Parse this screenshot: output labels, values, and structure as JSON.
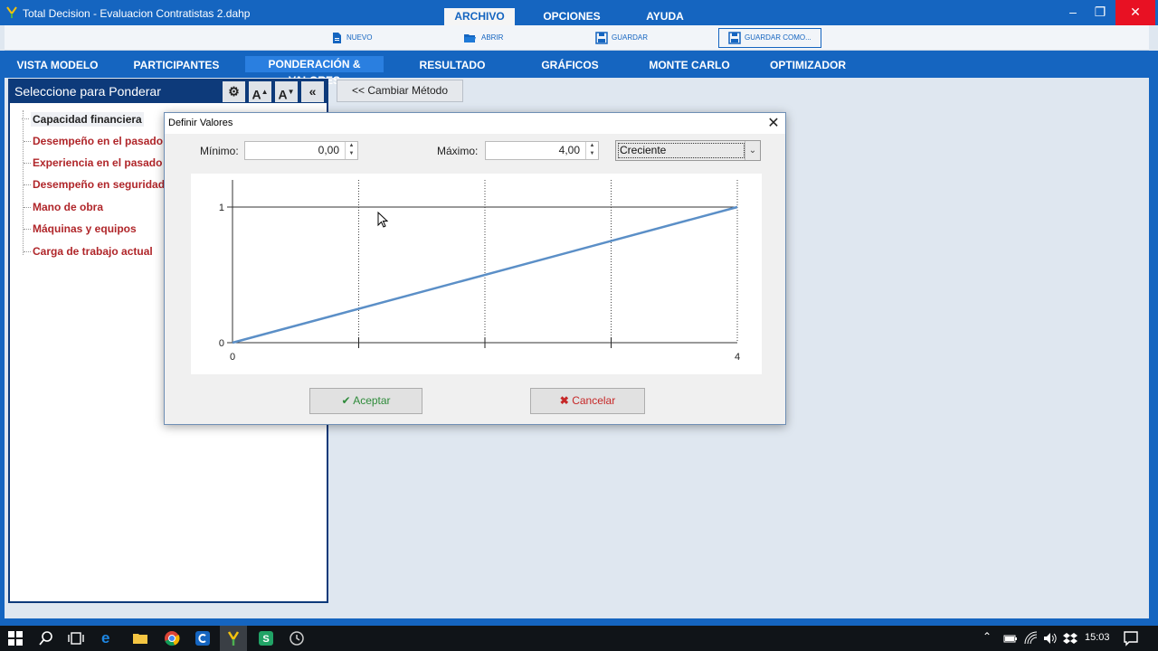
{
  "app": {
    "title": "Total Decision - Evaluacion Contratistas 2.dahp",
    "menu": [
      "ARCHIVO",
      "OPCIONES",
      "AYUDA"
    ],
    "window_controls": {
      "minimize": "–",
      "restore": "❐",
      "close": "✕"
    }
  },
  "toolbar": {
    "nuevo": "NUEVO",
    "abrir": "ABRIR",
    "guardar": "GUARDAR",
    "guardar_como": "GUARDAR COMO..."
  },
  "nav": {
    "tabs": [
      "VISTA MODELO",
      "PARTICIPANTES",
      "PONDERACIÓN & VALORES",
      "RESULTADO",
      "GRÁFICOS",
      "MONTE CARLO",
      "OPTIMIZADOR"
    ],
    "active": "PONDERACIÓN & VALORES"
  },
  "left_panel": {
    "title": "Seleccione para Ponderar",
    "buttons": {
      "settings": "⚙",
      "font_up": "A",
      "font_down": "A",
      "collapse": "«"
    },
    "items": [
      "Capacidad financiera",
      "Desempeño en el pasado",
      "Experiencia en el pasado",
      "Desempeño en seguridad",
      "Mano de obra",
      "Máquinas y equipos",
      "Carga de trabajo actual"
    ],
    "selected": "Capacidad financiera"
  },
  "main": {
    "cambiar_metodo": "<< Cambiar Método"
  },
  "dialog": {
    "title": "Definir Valores",
    "close": "✕",
    "minimo_label": "Mínimo:",
    "minimo_value": "0,00",
    "maximo_label": "Máximo:",
    "maximo_value": "4,00",
    "tipo_value": "Creciente",
    "aceptar": "Aceptar",
    "cancelar": "Cancelar"
  },
  "chart_data": {
    "type": "line",
    "x_ticks": [
      "0",
      "4"
    ],
    "y_ticks": [
      "0",
      "1"
    ],
    "xlim": [
      0,
      4
    ],
    "ylim": [
      0,
      1
    ],
    "x": [
      0,
      4
    ],
    "series": [
      {
        "values": [
          0,
          1
        ]
      }
    ],
    "reference_line_y": 1,
    "vertical_gridlines": [
      1,
      2,
      3,
      4
    ],
    "line_color": "#5b8fc7"
  },
  "taskbar": {
    "time": "15:03"
  },
  "colors": {
    "brand": "#1565c0",
    "panel_header": "#0d3a7a",
    "criteria_text": "#b0262a",
    "accept": "#2e8b3a",
    "cancel": "#c62828"
  }
}
